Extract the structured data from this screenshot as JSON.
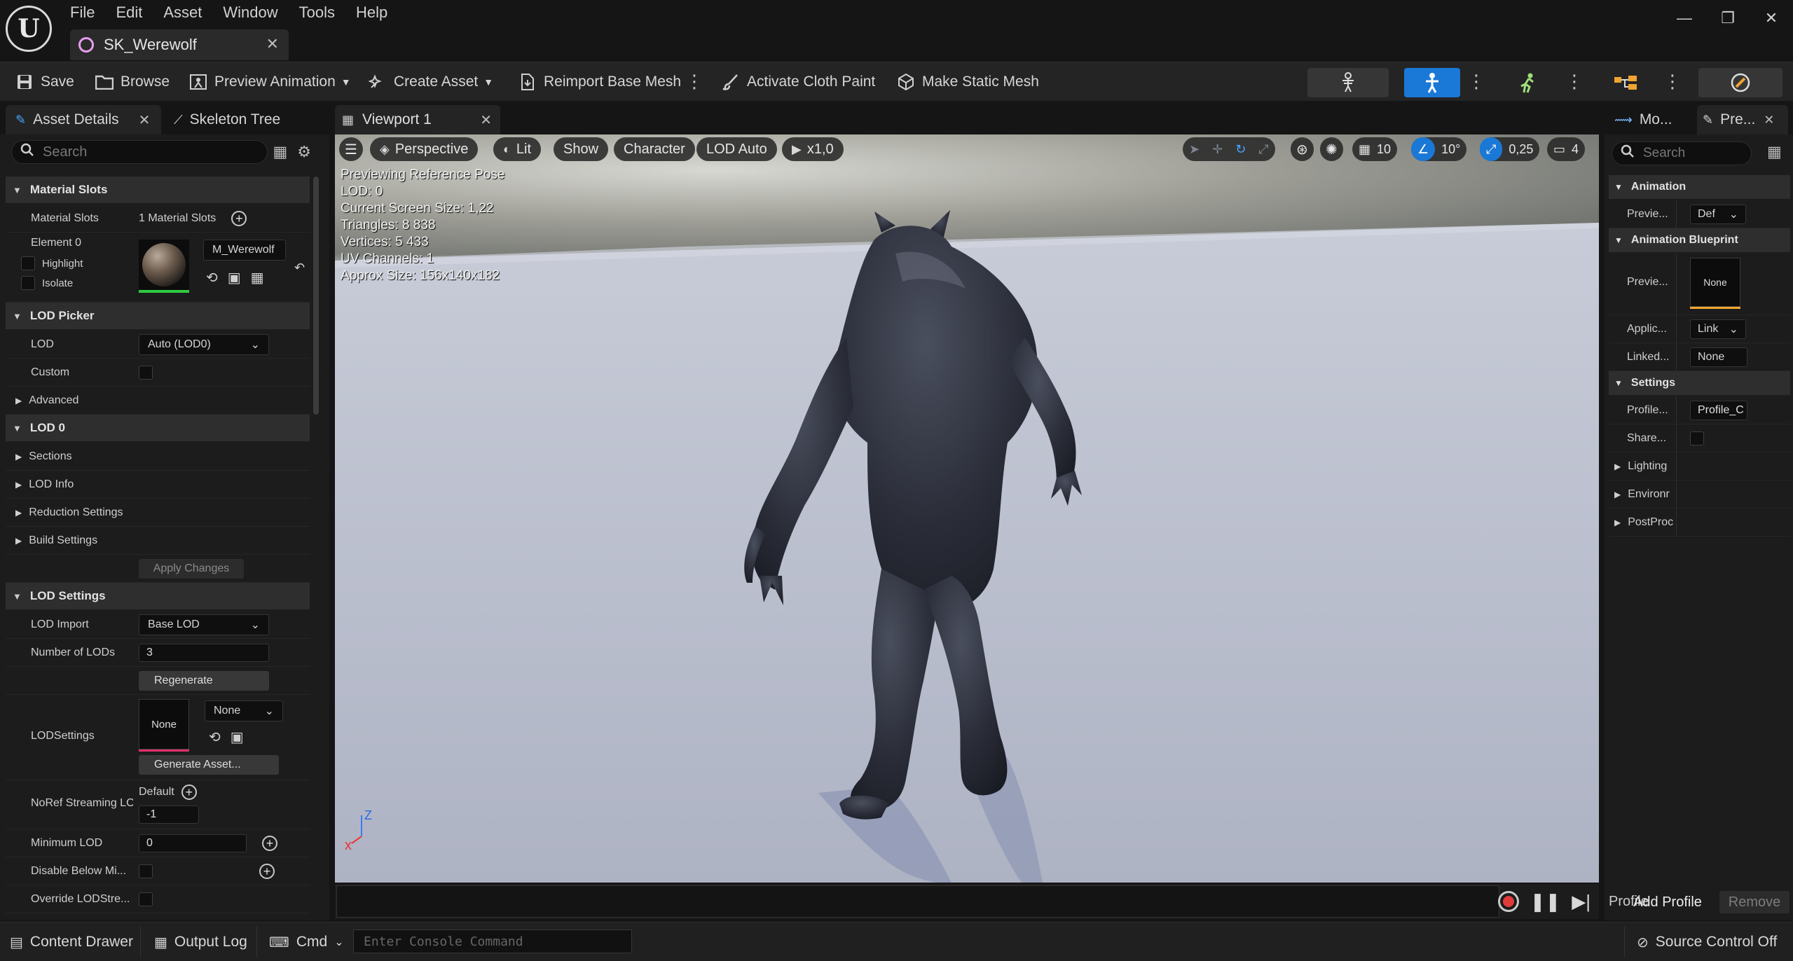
{
  "app": {
    "logo_glyph": "U",
    "menu": [
      "File",
      "Edit",
      "Asset",
      "Window",
      "Tools",
      "Help"
    ],
    "document_tab": "SK_Werewolf",
    "window_controls": [
      "—",
      "❐",
      "✕"
    ]
  },
  "toolbar": {
    "save": "Save",
    "browse": "Browse",
    "preview_animation": "Preview Animation",
    "create_asset": "Create Asset",
    "reimport_base_mesh": "Reimport Base Mesh",
    "activate_cloth_paint": "Activate Cloth Paint",
    "make_static_mesh": "Make Static Mesh",
    "mode_buttons": [
      "skeleton-mode",
      "mesh-mode",
      "animation-mode",
      "blueprint-mode",
      "physics-mode"
    ]
  },
  "left_panel": {
    "tabs": [
      "Asset Details",
      "Skeleton Tree"
    ],
    "search_placeholder": "Search",
    "material_slots": {
      "category": "Material Slots",
      "label": "Material Slots",
      "value": "1 Material Slots",
      "element": "Element 0",
      "material_name": "M_Werewolf",
      "highlight": "Highlight",
      "isolate": "Isolate"
    },
    "lod_picker": {
      "category": "LOD Picker",
      "lod_label": "LOD",
      "lod_value": "Auto (LOD0)",
      "custom_label": "Custom",
      "advanced": "Advanced"
    },
    "lod0": {
      "category": "LOD 0",
      "items": [
        "Sections",
        "LOD Info",
        "Reduction Settings",
        "Build Settings"
      ],
      "apply_changes": "Apply Changes"
    },
    "lod_settings": {
      "category": "LOD Settings",
      "lod_import_label": "LOD Import",
      "lod_import_value": "Base LOD",
      "num_lods_label": "Number of LODs",
      "num_lods_value": "3",
      "regenerate": "Regenerate",
      "lodsettings_label": "LODSettings",
      "lodsettings_thumb": "None",
      "lodsettings_value": "None",
      "generate_asset": "Generate Asset...",
      "noref_label": "NoRef Streaming LO",
      "noref_default": "Default",
      "noref_value": "-1",
      "min_lod_label": "Minimum LOD",
      "min_lod_value": "0",
      "disable_below_label": "Disable Below Mi...",
      "override_label": "Override LODStre..."
    }
  },
  "viewport": {
    "tab": "Viewport 1",
    "perspective": "Perspective",
    "lit": "Lit",
    "show": "Show",
    "character": "Character",
    "lod_auto": "LOD Auto",
    "play_rate": "x1,0",
    "grid_snap": "10",
    "rotation_snap": "10°",
    "scale_snap": "0,25",
    "camera_speed": "4",
    "stats": [
      "Previewing Reference Pose",
      "LOD: 0",
      "Current Screen Size: 1,22",
      "Triangles: 8 838",
      "Vertices: 5 433",
      "UV Channels: 1",
      "Approx Size: 156x140x182"
    ],
    "axis_z": "Z",
    "axis_x": "x"
  },
  "right_panel": {
    "tabs": [
      "Mo...",
      "Pre..."
    ],
    "search_placeholder": "Search",
    "animation": {
      "category": "Animation",
      "preview_label": "Previe...",
      "preview_value": "Def"
    },
    "animation_blueprint": {
      "category": "Animation Blueprint",
      "preview_label": "Previe...",
      "preview_value": "None",
      "application_label": "Applic...",
      "application_value": "Link",
      "linked_label": "Linked...",
      "linked_value": "None"
    },
    "settings": {
      "category": "Settings",
      "profile_label": "Profile...",
      "profile_value": "Profile_C",
      "shared_label": "Share...",
      "items": [
        "Lighting",
        "Environr",
        "PostProc"
      ]
    },
    "profile_prefix": "Profile",
    "add_profile": "Add Profile",
    "remove": "Remove"
  },
  "statusbar": {
    "content_drawer": "Content Drawer",
    "output_log": "Output Log",
    "cmd": "Cmd",
    "console_placeholder": "Enter Console Command",
    "source_control": "Source Control Off"
  },
  "colors": {
    "accent_blue": "#1a78d6",
    "material_underline": "#2ecc40",
    "none_underline": "#e0316a",
    "asset_icon": "#e79ff0"
  }
}
